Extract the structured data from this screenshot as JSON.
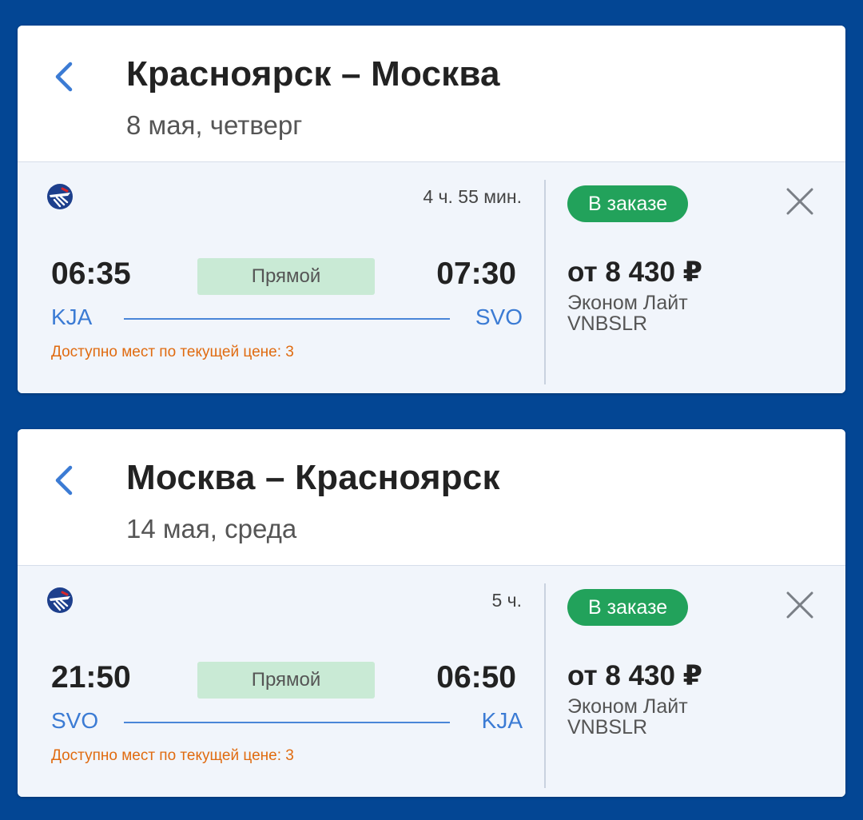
{
  "colors": {
    "background": "#034694",
    "accent": "#3b7bd4",
    "status_green": "#22a25b",
    "direct_badge": "#c9ead5",
    "warning_orange": "#e06b10"
  },
  "icons": {
    "back": "chevron-left-icon",
    "airline": "aeroflot-logo",
    "close": "close-icon"
  },
  "segments": [
    {
      "title": "Красноярск – Москва",
      "date": "8 мая, четверг",
      "flight": {
        "duration": "4 ч. 55 мин.",
        "departure_time": "06:35",
        "arrival_time": "07:30",
        "departure_code": "KJA",
        "arrival_code": "SVO",
        "type": "Прямой",
        "seats_note": "Доступно мест по текущей цене: 3",
        "status": "В заказе",
        "price": "от 8 430 ₽",
        "fare_class": "Эконом Лайт",
        "fare_code": "VNBSLR"
      }
    },
    {
      "title": "Москва – Красноярск",
      "date": "14 мая, среда",
      "flight": {
        "duration": "5 ч.",
        "departure_time": "21:50",
        "arrival_time": "06:50",
        "departure_code": "SVO",
        "arrival_code": "KJA",
        "type": "Прямой",
        "seats_note": "Доступно мест по текущей цене: 3",
        "status": "В заказе",
        "price": "от 8 430 ₽",
        "fare_class": "Эконом Лайт",
        "fare_code": "VNBSLR"
      }
    }
  ]
}
